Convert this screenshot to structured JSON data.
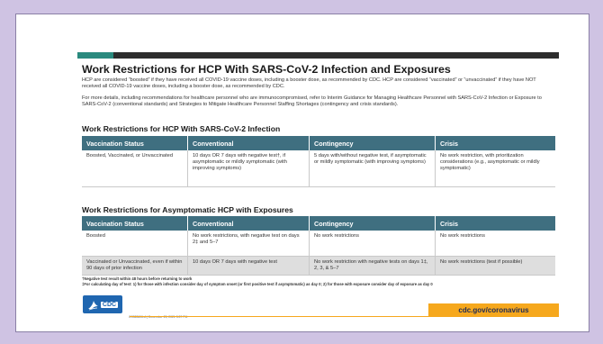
{
  "title": "Work Restrictions for HCP With SARS-CoV-2 Infection and Exposures",
  "intro": "HCP are considered “boosted” if they have received all COVID-19 vaccine doses, including a booster dose, as recommended by CDC. HCP are considered “vaccinated” or “unvaccinated” if they have NOT received all COVID-19 vaccine doses, including a booster dose, as recommended by CDC.",
  "details": "For more details, including recommendations for healthcare personnel who are immunocompromised, refer to Interim Guidance for Managing Healthcare Personnel with SARS-CoV-2 Infection or Exposure to SARS-CoV-2 (conventional standards) and Strategies to Mitigate Healthcare Personnel Staffing Shortages (contingency and crisis standards).",
  "table1": {
    "heading": "Work Restrictions for HCP With SARS-CoV-2 Infection",
    "headers": [
      "Vaccination Status",
      "Conventional",
      "Contingency",
      "Crisis"
    ],
    "rows": [
      [
        "Boosted, Vaccinated, or Unvaccinated",
        "10 days OR 7 days with negative test†, if asymptomatic or mildly symptomatic (with improving symptoms)",
        "5 days with/without negative test, if asymptomatic or mildly symptomatic (with improving symptoms)",
        "No work restriction, with prioritization considerations (e.g., asymptomatic or mildly symptomatic)"
      ]
    ]
  },
  "table2": {
    "heading": "Work Restrictions for Asymptomatic HCP with Exposures",
    "headers": [
      "Vaccination Status",
      "Conventional",
      "Contingency",
      "Crisis"
    ],
    "rows": [
      [
        "Boosted",
        "No work restrictions, with negative test on days 2‡ and 5–7",
        "No work restrictions",
        "No work restrictions"
      ],
      [
        "Vaccinated or Unvaccinated, even if within 90 days of prior infection",
        "10 days OR 7 days with negative test",
        "No work restriction with negative tests on days 1‡, 2, 3, & 5–7",
        "No work restrictions (test if possible)"
      ]
    ]
  },
  "footnotes": [
    "†Negative test result within 48 hours before returning to work",
    "‡For calculating day of test: 1) for those with infection consider day of symptom onset (or first positive test if asymptomatic) as day 0; 2) for those with exposure consider day of exposure as day 0"
  ],
  "footer": {
    "logo_text": "CDC",
    "small_print": "CS328606-A | December 23, 2021 3:37 PM",
    "url": "cdc.gov/coronavirus"
  },
  "colors": {
    "header_bg": "#3f6f80",
    "accent_teal": "#2a8a7e",
    "footer_yellow": "#f6a81d",
    "cdc_blue": "#1f66b0"
  }
}
